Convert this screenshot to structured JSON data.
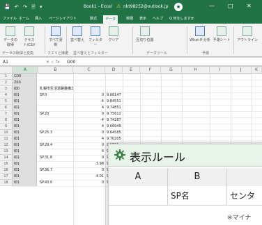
{
  "titlebar": {
    "qat": "💾 ↶ ↷ 🖹 ▾",
    "title": "Book1 - Excel",
    "warn_icon": "⚠",
    "account": "nkt98252@outlook.jp",
    "avatar": "●",
    "minimize": "—",
    "restore": "□",
    "close": "✕"
  },
  "tabs": [
    "ファイル",
    "ホーム",
    "挿入",
    "ページレイアウト",
    "数式",
    "データ",
    "校閲",
    "表示",
    "ヘルプ",
    "Q 何をしますか"
  ],
  "active_tab": "データ",
  "ribbon": {
    "buttons": [
      {
        "label": "データの取得"
      },
      {
        "label": "テキスト/CSV"
      },
      {
        "label": "すべて更新"
      },
      {
        "label": "並べ替え"
      },
      {
        "label": "フィルター"
      },
      {
        "label": "クリア"
      },
      {
        "label": "区切り位置"
      },
      {
        "label": "What-If 分析"
      },
      {
        "label": "予測シート"
      },
      {
        "label": "アウトライン"
      }
    ],
    "groups": [
      "データの取得と変換",
      "クエリと接続",
      "並べ替えとフィルター",
      "データツール",
      "予測"
    ]
  },
  "formula_bar": {
    "name_box": "A1",
    "fx": "✕ ✓ fx",
    "value": "G00"
  },
  "columns": [
    "A",
    "B",
    "C",
    "D",
    "E",
    "F",
    "G",
    "H",
    "I",
    "J",
    "K"
  ],
  "rows": [
    {
      "n": "1",
      "a": "G00",
      "b": "",
      "c": "",
      "d": ""
    },
    {
      "n": "2",
      "a": "Z00",
      "b": "",
      "c": "",
      "d": ""
    },
    {
      "n": "3",
      "a": "I00",
      "b": "札幌市生活道路整備工事",
      "c": "",
      "d": ""
    },
    {
      "n": "4",
      "a": "I01",
      "b": "SP.0",
      "c": "0",
      "d": "9.66147"
    },
    {
      "n": "5",
      "a": "I01",
      "b": "",
      "c": "-4",
      "d": "9.84551"
    },
    {
      "n": "6",
      "a": "I01",
      "b": "",
      "c": "4",
      "d": "9.74851"
    },
    {
      "n": "7",
      "a": "I01",
      "b": "SP.20",
      "c": "0",
      "d": "9.75612"
    },
    {
      "n": "8",
      "a": "I01",
      "b": "",
      "c": "-4",
      "d": "9.74287"
    },
    {
      "n": "9",
      "a": "I01",
      "b": "",
      "c": "4",
      "d": "9.66949"
    },
    {
      "n": "10",
      "a": "I01",
      "b": "SP.25.3",
      "c": "0",
      "d": "9.64585"
    },
    {
      "n": "11",
      "a": "I01",
      "b": "",
      "c": "4",
      "d": "9.70205"
    },
    {
      "n": "12",
      "a": "I01",
      "b": "SP.29.4",
      "c": "0",
      "d": "9.6621"
    },
    {
      "n": "13",
      "a": "I01",
      "b": "",
      "c": "4",
      "d": "9.70317"
    },
    {
      "n": "14",
      "a": "I01",
      "b": "SP.31.8",
      "c": "0",
      "d": "9.70022"
    },
    {
      "n": "15",
      "a": "I01",
      "b": "",
      "c": "-3.98",
      "d": "9.74239"
    },
    {
      "n": "16",
      "a": "I01",
      "b": "SP.36.7",
      "c": "0",
      "d": "9.76502"
    },
    {
      "n": "17",
      "a": "I01",
      "b": "",
      "c": "-4.01",
      "d": "9.70098"
    },
    {
      "n": "18",
      "a": "I01",
      "b": "SP.43.0",
      "c": "0",
      "d": "9.69866"
    }
  ],
  "overlay": {
    "title": "表示ルール",
    "col_a": "A",
    "col_b": "B",
    "cell_b": "SP名",
    "cell_c": "センタ",
    "note": "※マイナ"
  },
  "colors": {
    "excel_green": "#217346",
    "overlay_head": "#e8f4ea",
    "gear": "#3a7d44"
  }
}
